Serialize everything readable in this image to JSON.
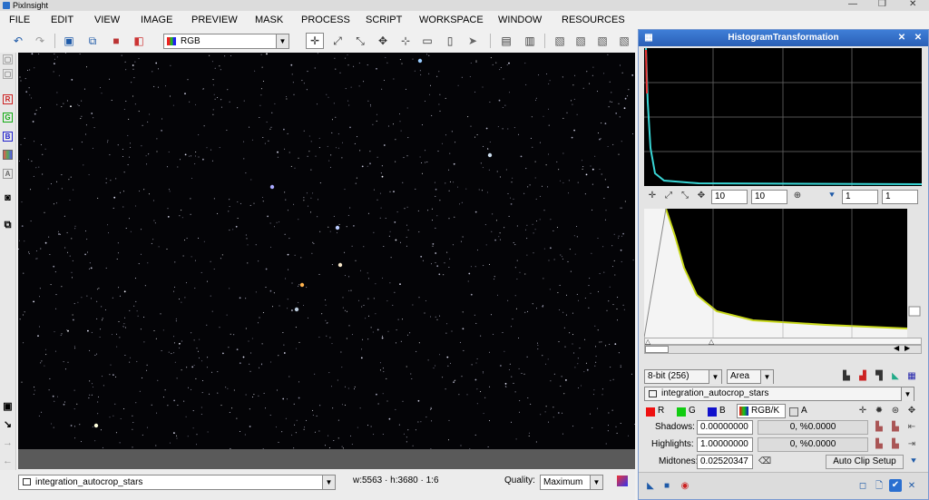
{
  "app": {
    "title": "PixInsight"
  },
  "menu": [
    "FILE",
    "EDIT",
    "VIEW",
    "IMAGE",
    "PREVIEW",
    "MASK",
    "PROCESS",
    "SCRIPT",
    "WORKSPACE",
    "WINDOW",
    "RESOURCES"
  ],
  "toolbar": {
    "channel_select": "RGB"
  },
  "left_strip": [
    "R",
    "G",
    "B",
    "A"
  ],
  "status": {
    "view_name": "integration_autocrop_stars",
    "dimensions": "w:5563 · h:3680 · 1:6",
    "quality_label": "Quality:",
    "quality_value": "Maximum"
  },
  "histogram": {
    "title": "HistogramTransformation",
    "zoom_h": "10",
    "zoom_v": "10",
    "channel_a": "1",
    "channel_b": "1",
    "bit_depth": "8-bit (256)",
    "graph_style": "Area",
    "view_name": "integration_autocrop_stars",
    "channels": [
      "R",
      "G",
      "B",
      "RGB/K",
      "A"
    ],
    "shadows_label": "Shadows:",
    "shadows_value": "0.00000000",
    "shadows_clip": "0, %0.0000",
    "highlights_label": "Highlights:",
    "highlights_value": "1.00000000",
    "highlights_clip": "0, %0.0000",
    "midtones_label": "Midtones:",
    "midtones_value": "0.02520347",
    "auto_clip_label": "Auto Clip Setup"
  },
  "colors": {
    "accent": "#2a5fb5",
    "titlebar_blue": "#3f7fd8",
    "image_bg": "#040407"
  }
}
